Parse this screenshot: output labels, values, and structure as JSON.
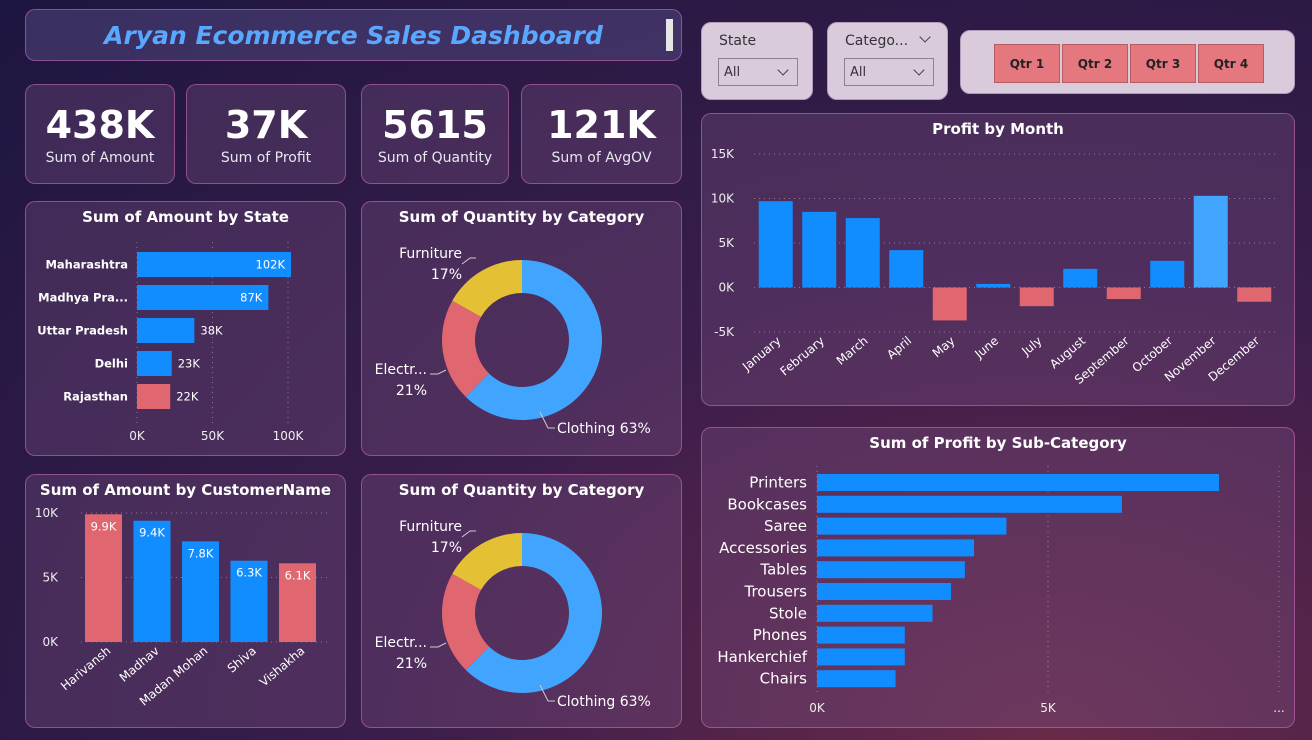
{
  "header": {
    "title": "Aryan Ecommerce Sales Dashboard"
  },
  "kpis": [
    {
      "value": "438K",
      "label": "Sum of Amount"
    },
    {
      "value": "37K",
      "label": "Sum of Profit"
    },
    {
      "value": "5615",
      "label": "Sum of Quantity"
    },
    {
      "value": "121K",
      "label": "Sum of AvgOV"
    }
  ],
  "slicers": {
    "state": {
      "label": "State",
      "value": "All"
    },
    "category": {
      "label": "Catego...",
      "value": "All"
    }
  },
  "quarters": [
    "Qtr 1",
    "Qtr 2",
    "Qtr 3",
    "Qtr 4"
  ],
  "colors": {
    "blue": "#118dff",
    "light_blue": "#41a4ff",
    "red": "#e0676f",
    "yellow": "#e4c134"
  },
  "chart_data": [
    {
      "id": "amount_by_state",
      "type": "bar",
      "orientation": "horizontal",
      "title": "Sum of Amount by State",
      "categories": [
        "Maharashtra",
        "Madhya Pra...",
        "Uttar Pradesh",
        "Delhi",
        "Rajasthan"
      ],
      "values": [
        102,
        87,
        38,
        23,
        22
      ],
      "value_labels": [
        "102K",
        "87K",
        "38K",
        "23K",
        "22K"
      ],
      "highlight": [
        "blue",
        "blue",
        "blue",
        "blue",
        "red"
      ],
      "xticks": [
        "0K",
        "50K",
        "100K"
      ],
      "xlim": [
        0,
        100
      ]
    },
    {
      "id": "quantity_by_category_1",
      "type": "pie",
      "donut": true,
      "title": "Sum of Quantity by Category",
      "slices": [
        {
          "name": "Clothing",
          "percent": 63,
          "label": "Clothing 63%",
          "color": "light_blue"
        },
        {
          "name": "Electr...",
          "percent": 21,
          "label_name": "Electr...",
          "label_pct": "21%",
          "color": "red"
        },
        {
          "name": "Furniture",
          "percent": 17,
          "label_name": "Furniture",
          "label_pct": "17%",
          "color": "yellow"
        }
      ]
    },
    {
      "id": "amount_by_customer",
      "type": "bar",
      "orientation": "vertical",
      "title": "Sum of Amount by CustomerName",
      "categories": [
        "Harivansh",
        "Madhav",
        "Madan Mohan",
        "Shiva",
        "Vishakha"
      ],
      "values": [
        9.9,
        9.4,
        7.8,
        6.3,
        6.1
      ],
      "value_labels": [
        "9.9K",
        "9.4K",
        "7.8K",
        "6.3K",
        "6.1K"
      ],
      "highlight": [
        "red",
        "blue",
        "blue",
        "blue",
        "red"
      ],
      "yticks": [
        "0K",
        "5K",
        "10K"
      ],
      "ylim": [
        0,
        10
      ]
    },
    {
      "id": "quantity_by_category_2",
      "type": "pie",
      "donut": true,
      "title": "Sum of Quantity by Category",
      "slices": [
        {
          "name": "Clothing",
          "percent": 63,
          "label": "Clothing 63%",
          "color": "light_blue"
        },
        {
          "name": "Electr...",
          "percent": 21,
          "label_name": "Electr...",
          "label_pct": "21%",
          "color": "red"
        },
        {
          "name": "Furniture",
          "percent": 17,
          "label_name": "Furniture",
          "label_pct": "17%",
          "color": "yellow"
        }
      ]
    },
    {
      "id": "profit_by_month",
      "type": "bar",
      "orientation": "vertical",
      "title": "Profit by Month",
      "categories": [
        "January",
        "February",
        "March",
        "April",
        "May",
        "June",
        "July",
        "August",
        "September",
        "October",
        "November",
        "December"
      ],
      "values": [
        9.7,
        8.5,
        7.8,
        4.2,
        -3.7,
        0.4,
        -2.1,
        2.1,
        -1.3,
        3.0,
        10.3,
        -1.6
      ],
      "yticks": [
        "-5K",
        "0K",
        "5K",
        "10K",
        "15K"
      ],
      "ylim": [
        -5,
        15
      ]
    },
    {
      "id": "profit_by_subcategory",
      "type": "bar",
      "orientation": "horizontal",
      "title": "Sum of Profit by Sub-Category",
      "categories": [
        "Printers",
        "Bookcases",
        "Saree",
        "Accessories",
        "Tables",
        "Trousers",
        "Stole",
        "Phones",
        "Hankerchief",
        "Chairs"
      ],
      "values": [
        8.7,
        6.6,
        4.1,
        3.4,
        3.2,
        2.9,
        2.5,
        1.9,
        1.9,
        1.7
      ],
      "xticks": [
        "0K",
        "5K",
        "..."
      ],
      "xlim": [
        0,
        10
      ]
    }
  ]
}
